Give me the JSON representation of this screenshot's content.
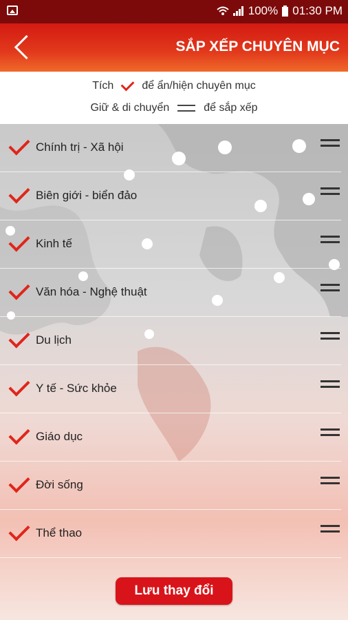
{
  "status_bar": {
    "battery": "100%",
    "time": "01:30 PM"
  },
  "header": {
    "title": "SẮP XẾP CHUYÊN MỤC"
  },
  "hints": {
    "line1_prefix": "Tích",
    "line1_suffix": "để ẩn/hiện chuyên mục",
    "line2_prefix": "Giữ & di chuyển",
    "line2_suffix": "để sắp xếp"
  },
  "categories": [
    {
      "label": "Chính trị - Xã hội",
      "checked": true
    },
    {
      "label": "Biên giới - biển đảo",
      "checked": true
    },
    {
      "label": "Kinh tế",
      "checked": true
    },
    {
      "label": "Văn hóa - Nghệ thuật",
      "checked": true
    },
    {
      "label": "Du lịch",
      "checked": true
    },
    {
      "label": "Y tế - Sức khỏe",
      "checked": true
    },
    {
      "label": "Giáo dục",
      "checked": true
    },
    {
      "label": "Đời sống",
      "checked": true
    },
    {
      "label": "Thể thao",
      "checked": true
    }
  ],
  "save_button": "Lưu thay đổi",
  "colors": {
    "accent": "#e0251b",
    "header": "#d31a12",
    "status_bar": "#7d0a0a"
  },
  "icons": {
    "back": "back-arrow-icon",
    "check": "check-icon",
    "drag": "drag-handle-icon"
  }
}
